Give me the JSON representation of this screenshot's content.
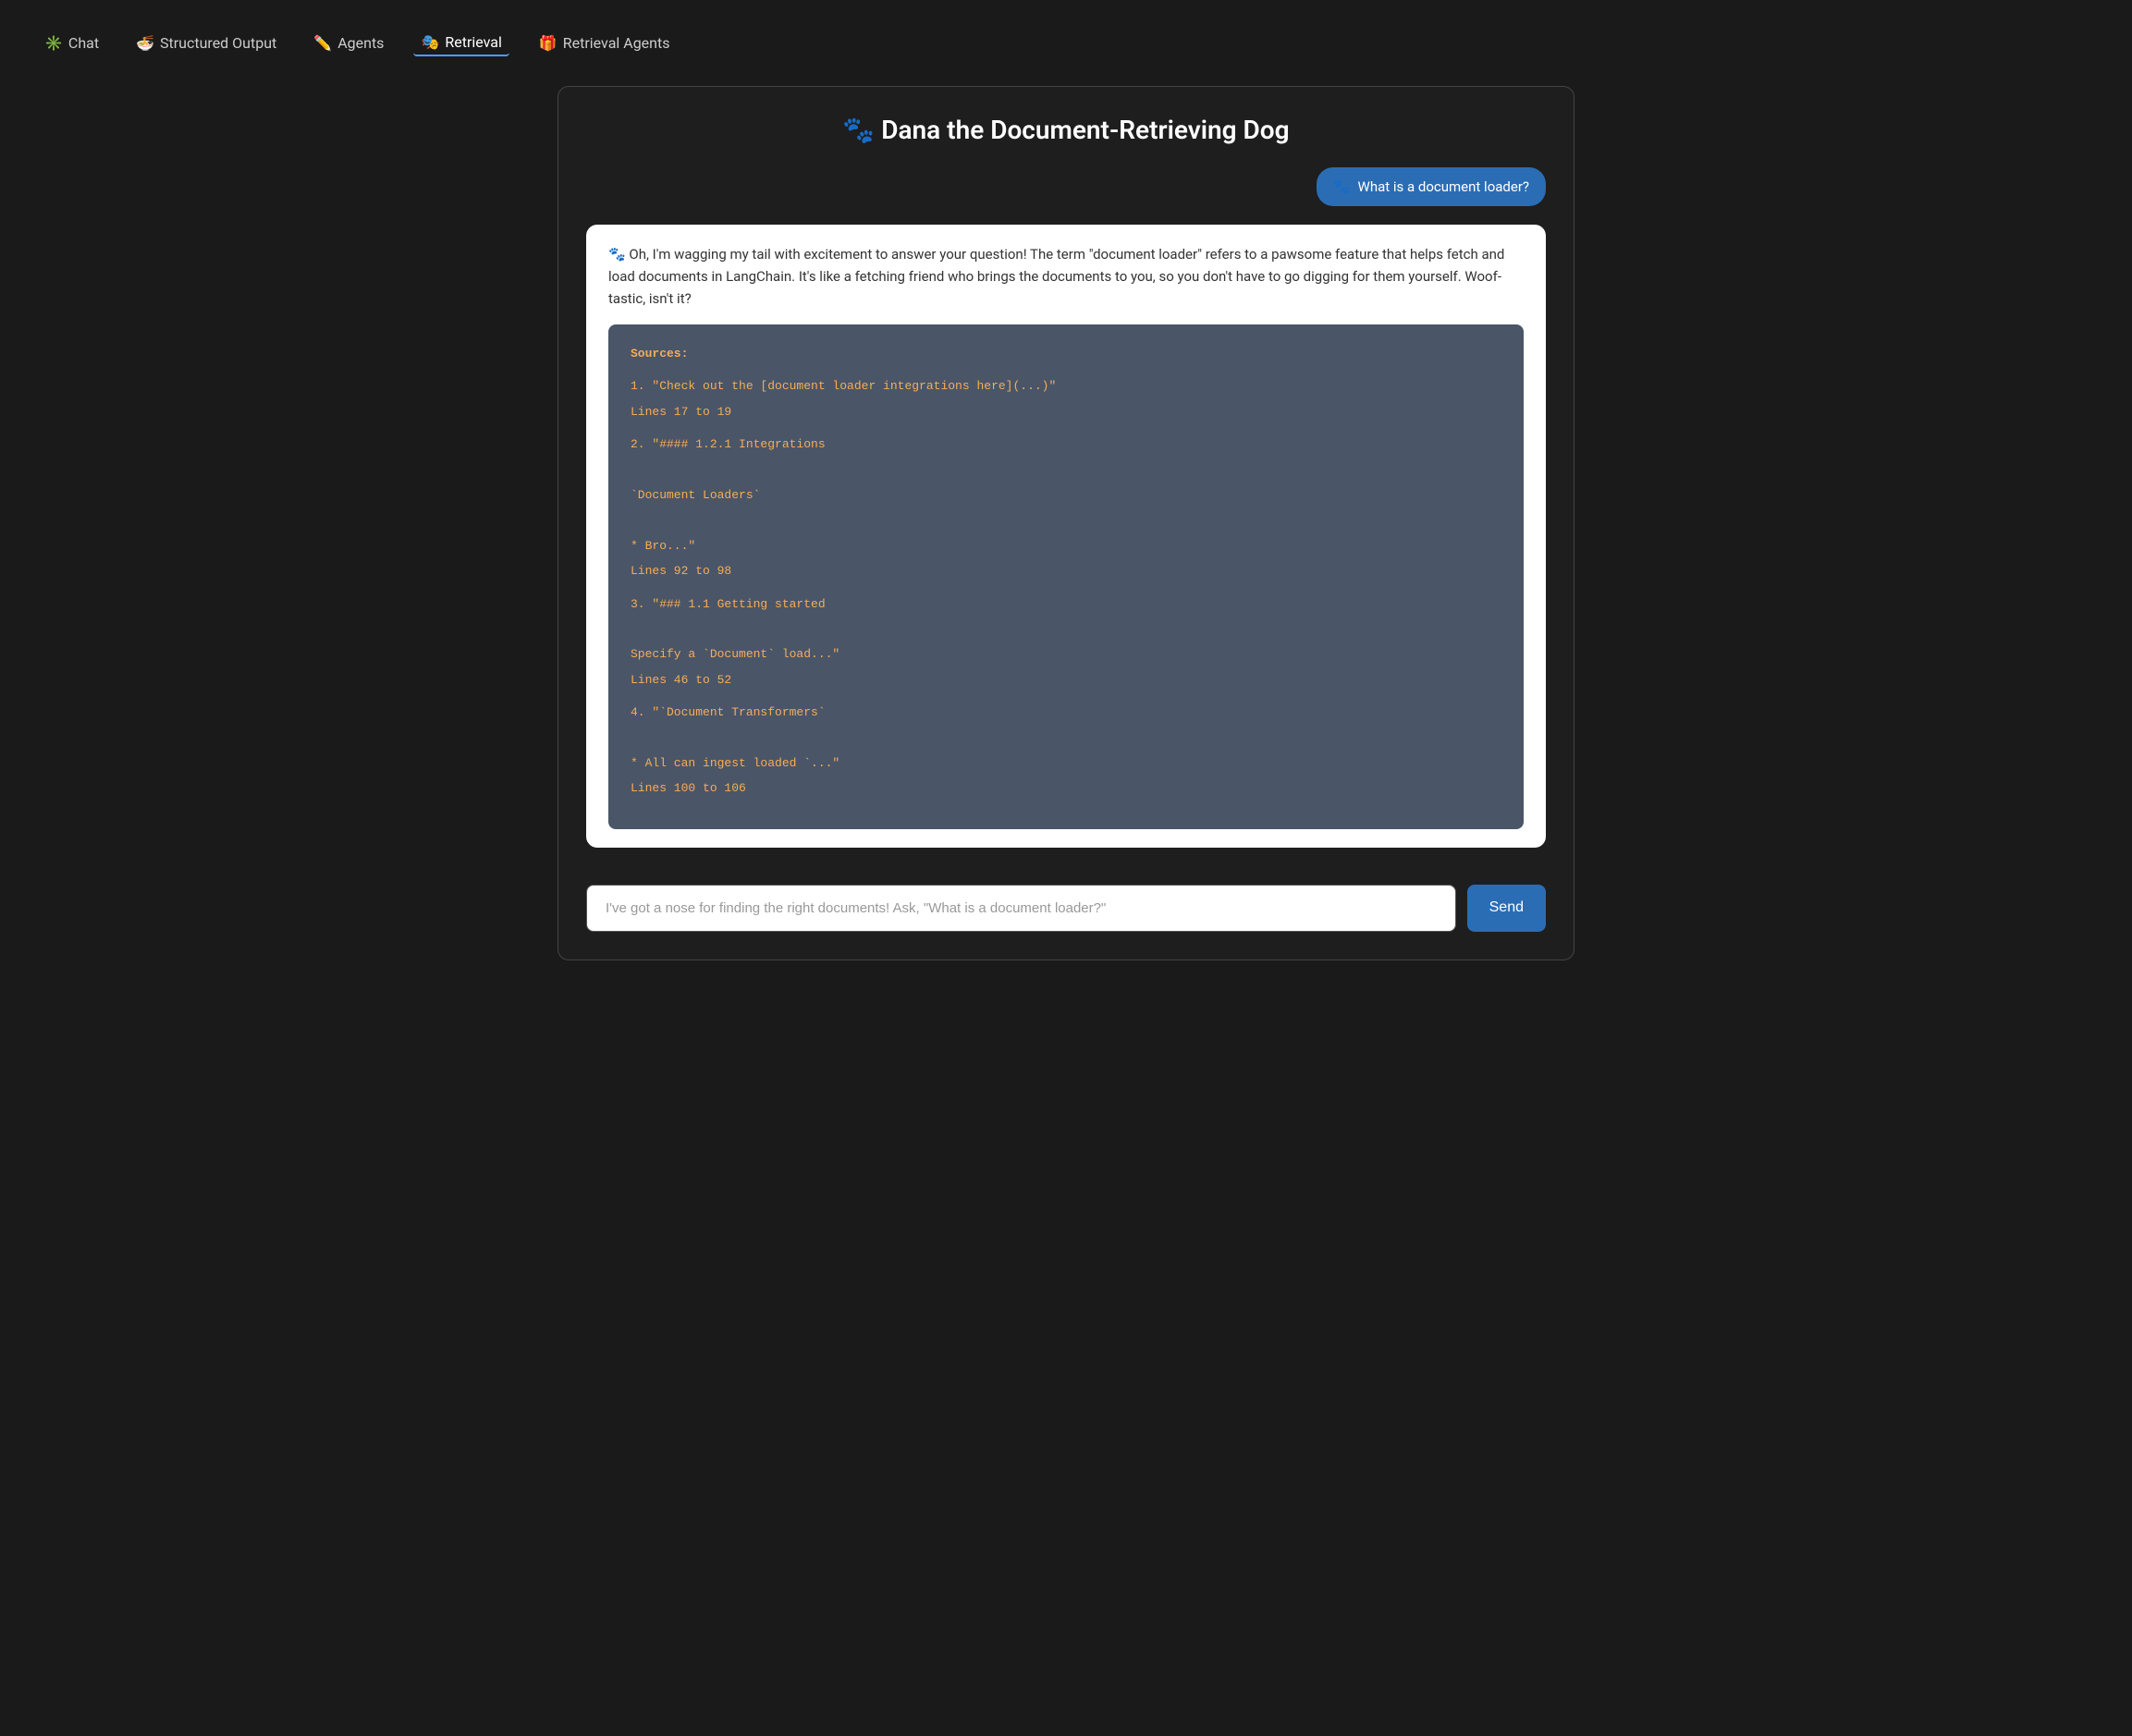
{
  "nav": {
    "items": [
      {
        "id": "chat",
        "icon": "✳️",
        "label": "Chat",
        "active": false
      },
      {
        "id": "structured-output",
        "icon": "🍜",
        "label": "Structured Output",
        "active": false
      },
      {
        "id": "agents",
        "icon": "✏️",
        "label": "Agents",
        "active": false
      },
      {
        "id": "retrieval",
        "icon": "🎭",
        "label": "Retrieval",
        "active": true
      },
      {
        "id": "retrieval-agents",
        "icon": "🎁",
        "label": "Retrieval Agents",
        "active": false
      }
    ]
  },
  "page": {
    "title": "🐾 Dana the Document-Retrieving Dog"
  },
  "user_message": {
    "icon": "🐾",
    "text": "What is a document loader?"
  },
  "assistant": {
    "icon": "🐾",
    "intro": "Oh, I'm wagging my tail with excitement to answer your question! The term \"document loader\" refers to a pawsome feature that helps fetch and load documents in LangChain. It's like a fetching friend who brings the documents to you, so you don't have to go digging for them yourself. Woof-tastic, isn't it?",
    "sources_label": "Sources:",
    "sources": [
      {
        "number": "1.",
        "quote": "\"Check out the [document loader integrations here](...)\"",
        "lines": "Lines 17 to 19"
      },
      {
        "number": "2.",
        "quote": "\"#### 1.2.1 Integrations\n\n`Document Loaders`\n\n* Bro...\"",
        "lines": "Lines 92 to 98"
      },
      {
        "number": "3.",
        "quote": "\"### 1.1 Getting started\n\nSpecify a `Document` load...\"",
        "lines": "Lines 46 to 52"
      },
      {
        "number": "4.",
        "quote": "\"`Document Transformers`\n\n* All can ingest loaded `...\"",
        "lines": "Lines 100 to 106"
      }
    ]
  },
  "input": {
    "placeholder": "I've got a nose for finding the right documents! Ask, \"What is a document loader?\"",
    "send_label": "Send"
  }
}
